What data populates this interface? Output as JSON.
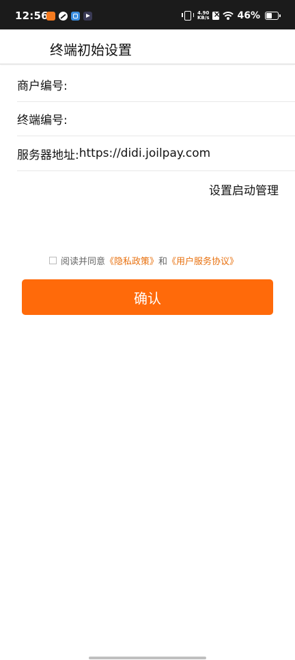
{
  "status_bar": {
    "time": "12:56",
    "net_speed_value": "4.90",
    "net_speed_unit": "KB/s",
    "battery_percent": "46%"
  },
  "header": {
    "title": "终端初始设置"
  },
  "form": {
    "merchant_label": "商户编号:",
    "merchant_value": "",
    "terminal_label": "终端编号:",
    "terminal_value": "",
    "server_label": "服务器地址:",
    "server_value": "https://didi.joilpay.com"
  },
  "startup_manage_label": "设置启动管理",
  "agreement": {
    "checked": false,
    "prefix": "阅读并同意",
    "privacy_link": "《隐私政策》",
    "and": "和",
    "service_link": "《用户服务协议》"
  },
  "confirm_label": "确认",
  "colors": {
    "accent": "#ff6a0a",
    "link": "#e8700e",
    "status_bar_bg": "#1b1b1b"
  }
}
